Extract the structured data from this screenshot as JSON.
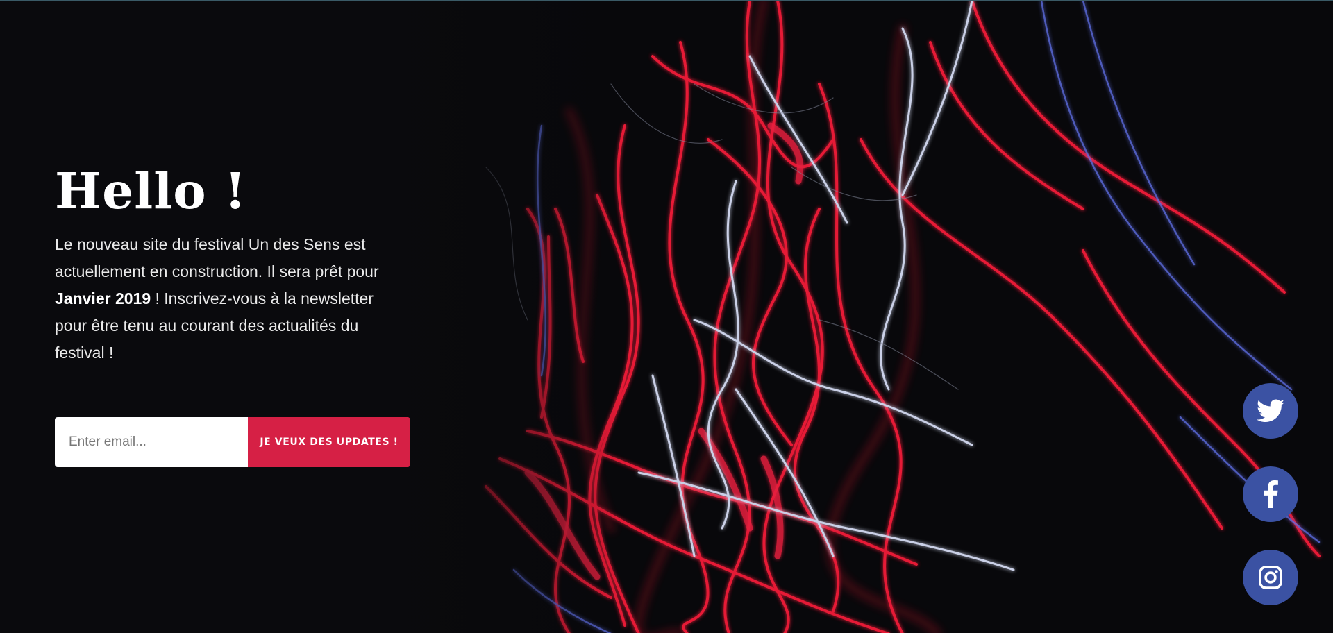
{
  "hero": {
    "headline": "Hello !",
    "intro_part1": "Le nouveau site du festival Un des Sens est actuellement en construction. Il sera prêt pour ",
    "intro_highlight": "Janvier 2019",
    "intro_part2": " ! Inscrivez-vous à la newsletter pour être tenu au courant des actualités du festival !"
  },
  "newsletter": {
    "email_placeholder": "Enter email...",
    "email_value": "",
    "submit_label": "JE VEUX DES UPDATES !"
  },
  "social": [
    {
      "name": "twitter",
      "icon": "twitter-icon"
    },
    {
      "name": "facebook",
      "icon": "facebook-icon"
    },
    {
      "name": "instagram",
      "icon": "instagram-icon"
    }
  ],
  "colors": {
    "background": "#0a0a0d",
    "accent_red": "#d62045",
    "social_blue": "#3b52a3",
    "text_white": "#ffffff"
  }
}
